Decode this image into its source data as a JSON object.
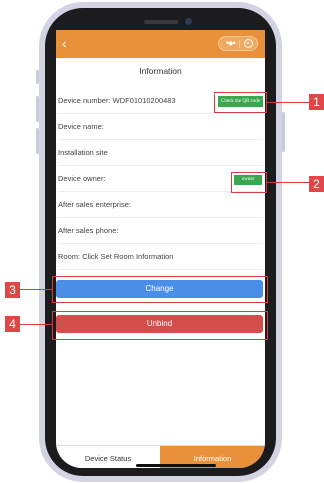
{
  "header": {
    "title": "Information"
  },
  "rows": [
    {
      "label": "Device number:",
      "value": "WDF01010200483"
    },
    {
      "label": "Device name:",
      "value": ""
    },
    {
      "label": "Installation site",
      "value": ""
    },
    {
      "label": "Device owner:",
      "value": ""
    },
    {
      "label": "After sales enterprise:",
      "value": ""
    },
    {
      "label": "After sales phone:",
      "value": ""
    },
    {
      "label": "Room:",
      "value": "Click Set Room Information"
    }
  ],
  "qr_button": "Check the QR code",
  "owner_button": "owner",
  "change_button": "Change",
  "unbind_button": "Unbind",
  "tabs": [
    {
      "label": "Device Status"
    },
    {
      "label": "Information"
    }
  ],
  "callouts": [
    "1",
    "2",
    "3",
    "4"
  ],
  "colors": {
    "accent": "#e8903a",
    "change": "#4a8fe7",
    "unbind": "#d44d4a",
    "tag": "#3aa64e",
    "callout": "#e04848"
  },
  "icons": [
    "back-icon",
    "more-icon",
    "close-icon"
  ]
}
